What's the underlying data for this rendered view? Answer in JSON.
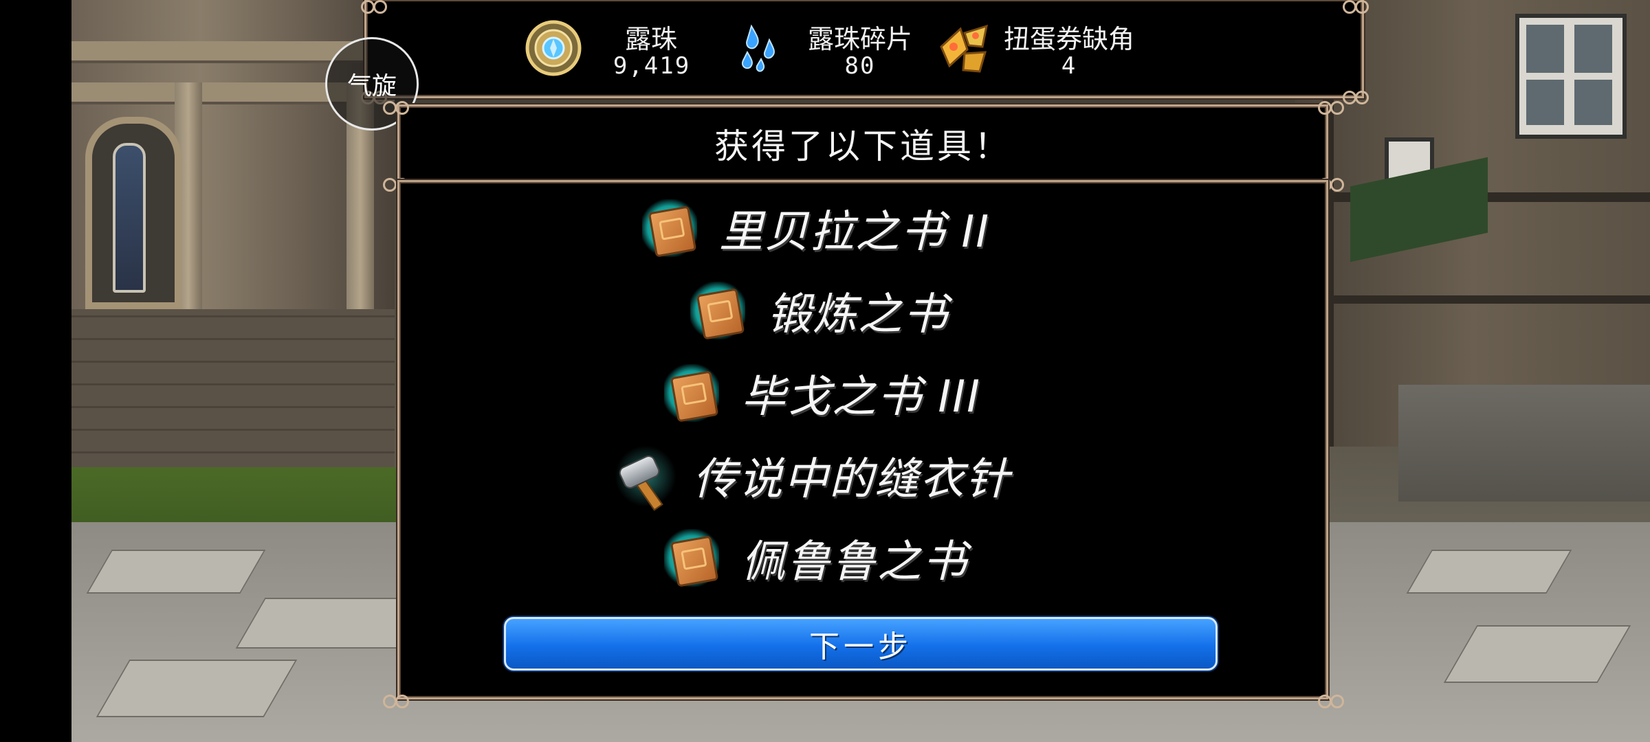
{
  "currencies": [
    {
      "label": "露珠",
      "value": "9,419",
      "icon": "dew-orb-icon"
    },
    {
      "label": "露珠碎片",
      "value": "80",
      "icon": "dew-fragments-icon"
    },
    {
      "label": "扭蛋券缺角",
      "value": "4",
      "icon": "gacha-ticket-fragment-icon"
    }
  ],
  "whirl_button": {
    "label": "气旋"
  },
  "dialog": {
    "title": "获得了以下道具！",
    "items": [
      {
        "name": "里贝拉之书 II",
        "icon": "book-icon"
      },
      {
        "name": "锻炼之书",
        "icon": "book-icon"
      },
      {
        "name": "毕戈之书 III",
        "icon": "book-icon"
      },
      {
        "name": "传说中的缝衣针",
        "icon": "hammer-icon"
      },
      {
        "name": "佩鲁鲁之书",
        "icon": "book-icon"
      }
    ],
    "next_label": "下一步"
  },
  "colors": {
    "accent_button": "#1470ea",
    "frame": "#bfa48b",
    "item_glow": "#49d9cf"
  }
}
